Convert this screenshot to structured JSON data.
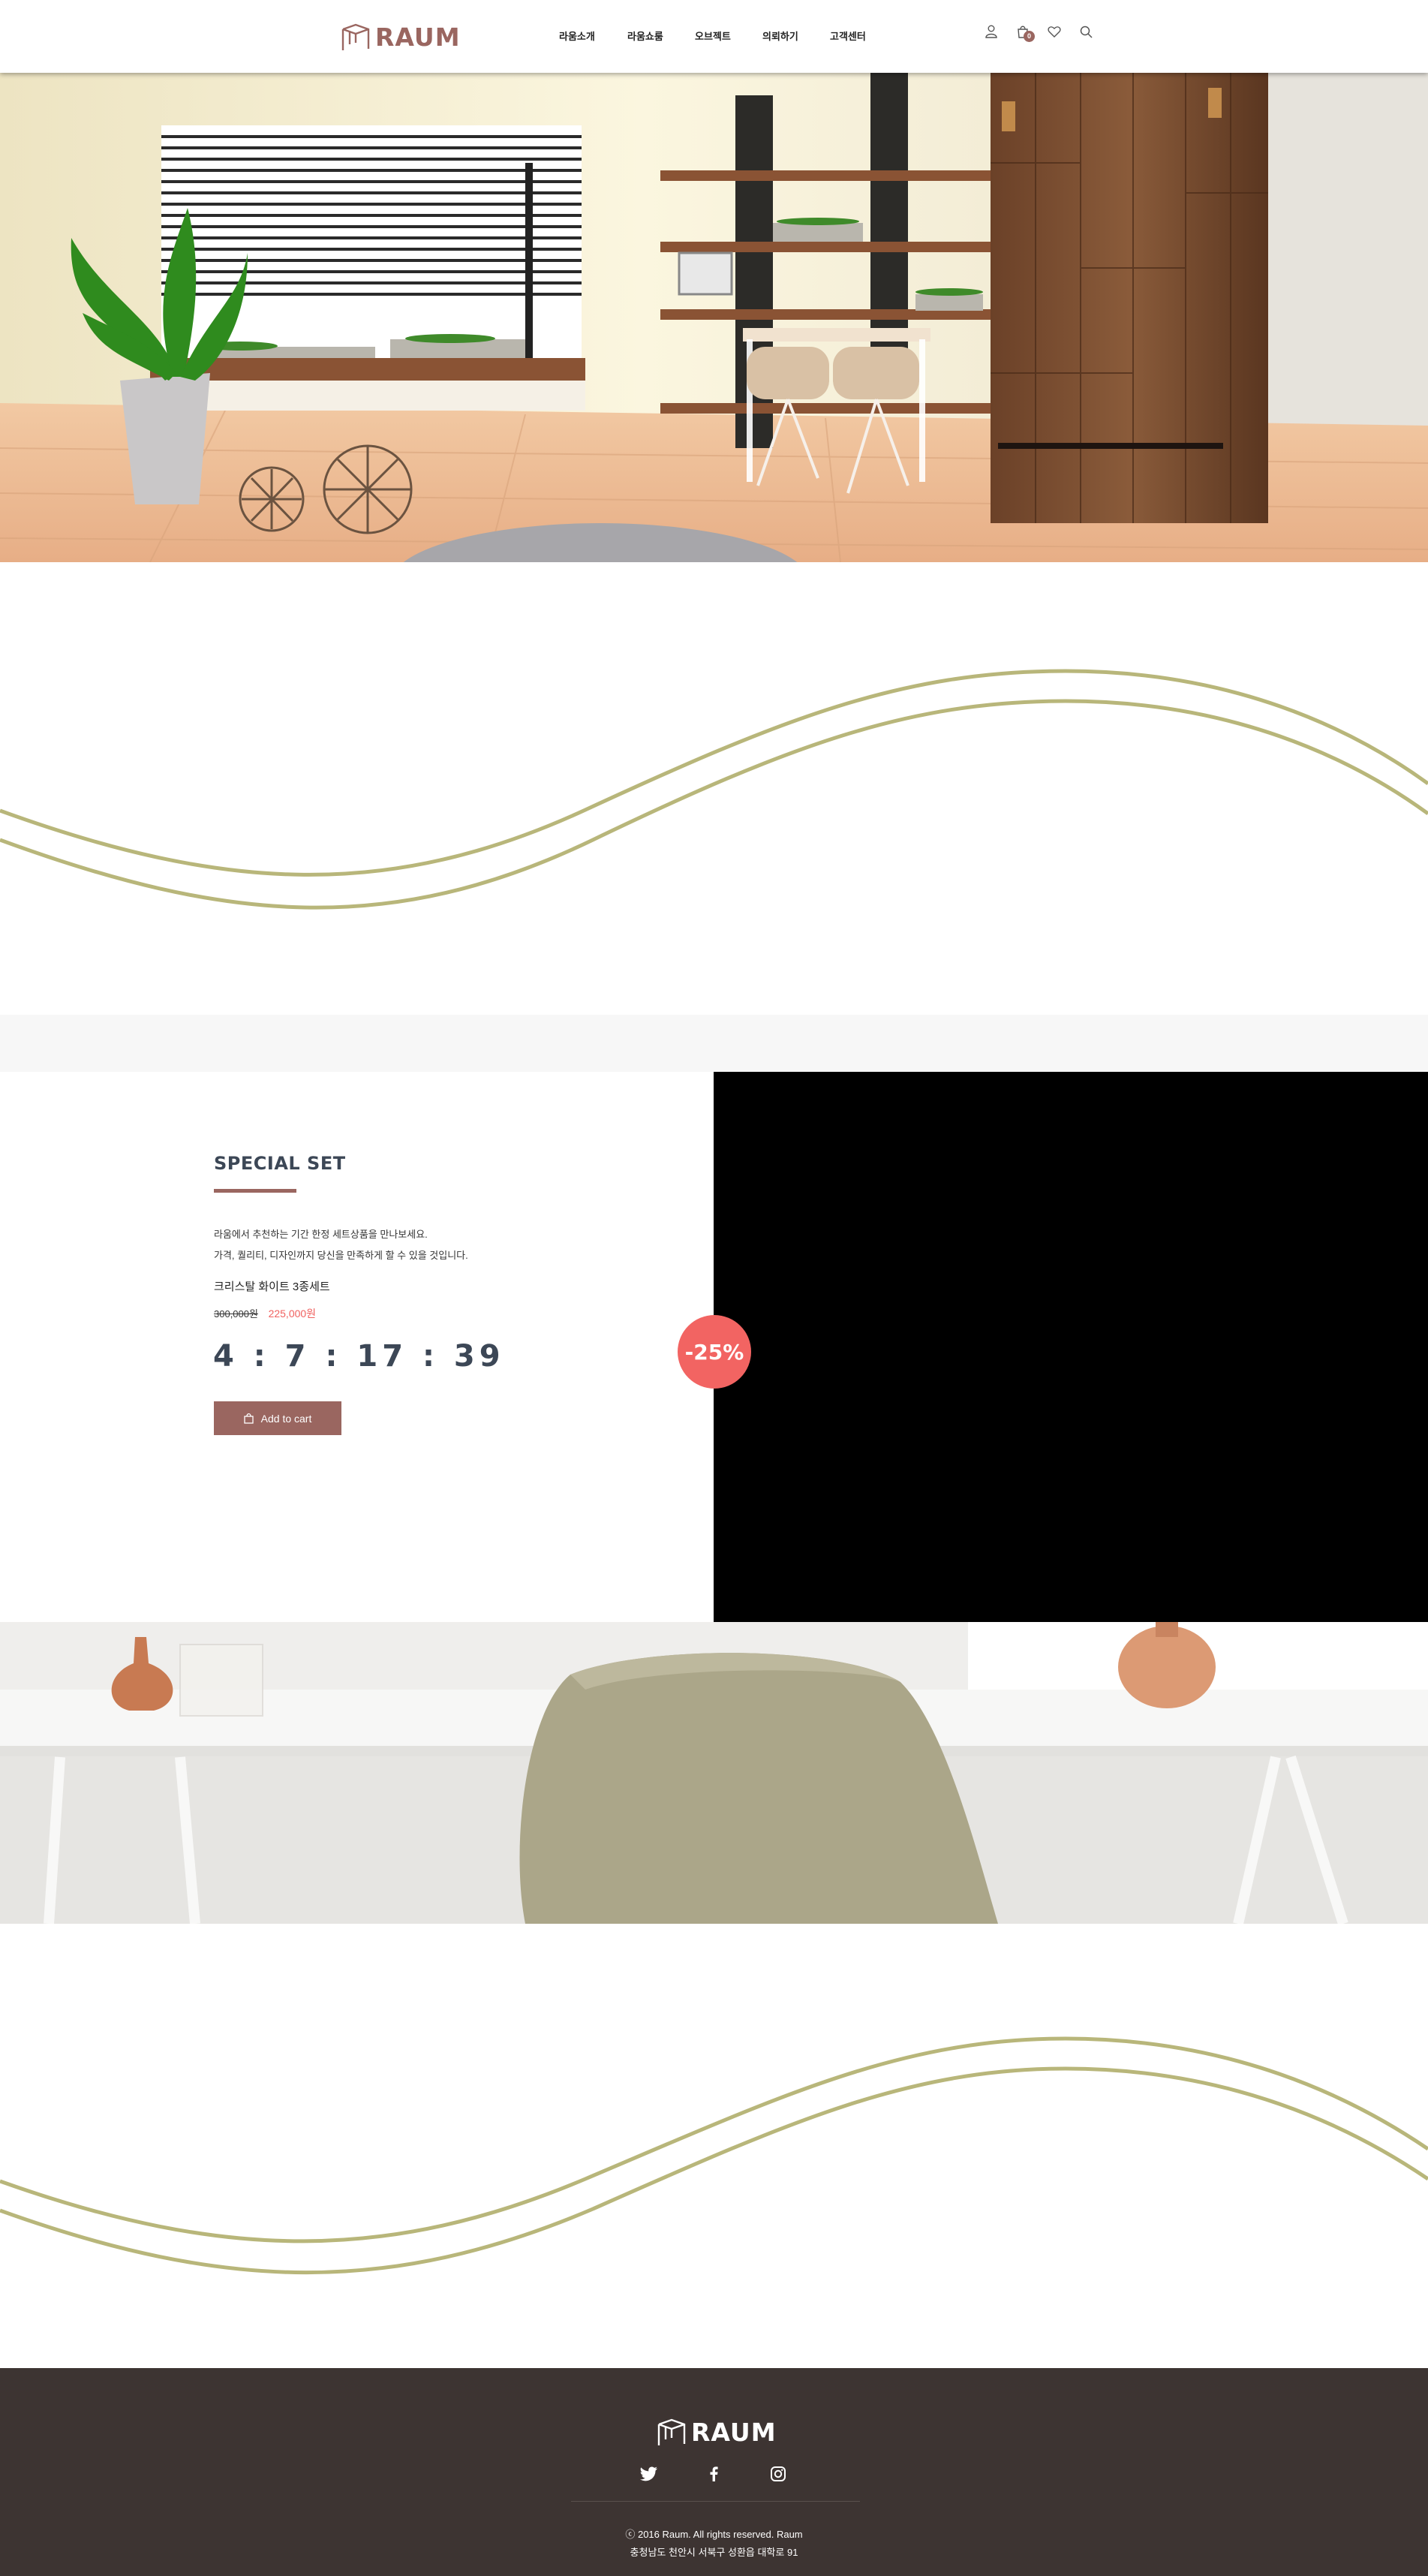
{
  "header": {
    "logo_text": "RAUM",
    "nav": [
      "라움소개",
      "라움쇼룸",
      "오브젝트",
      "의뢰하기",
      "고객센터"
    ],
    "cart_count": "0",
    "icons": [
      "user-icon",
      "cart-icon",
      "heart-icon",
      "search-icon"
    ]
  },
  "special": {
    "title": "SPECIAL SET",
    "desc_line1": "라움에서 추천하는 기간 한정 세트상품을 만나보세요.",
    "desc_line2": "가격, 퀄리티, 디자인까지 당신을 만족하게 할 수 있을 것입니다.",
    "product_name": "크리스탈 화이트 3종세트",
    "old_price": "300,000원",
    "new_price": "225,000원",
    "timer": "4 : 7 : 17 : 39",
    "button_label": "Add to cart",
    "discount_badge": "-25%"
  },
  "footer": {
    "logo_text": "RAUM",
    "social": [
      "twitter-icon",
      "facebook-icon",
      "instagram-icon"
    ],
    "copyright": "ⓒ 2016 Raum. All rights reserved. Raum",
    "address": "충청남도 천안시 서북구 성환읍 대학로 91"
  },
  "colors": {
    "brand": "#9a6660",
    "accent_red": "#f26462",
    "wave_line": "#b8b67a",
    "footer_bg": "#3d3432",
    "heading": "#3c4756"
  }
}
